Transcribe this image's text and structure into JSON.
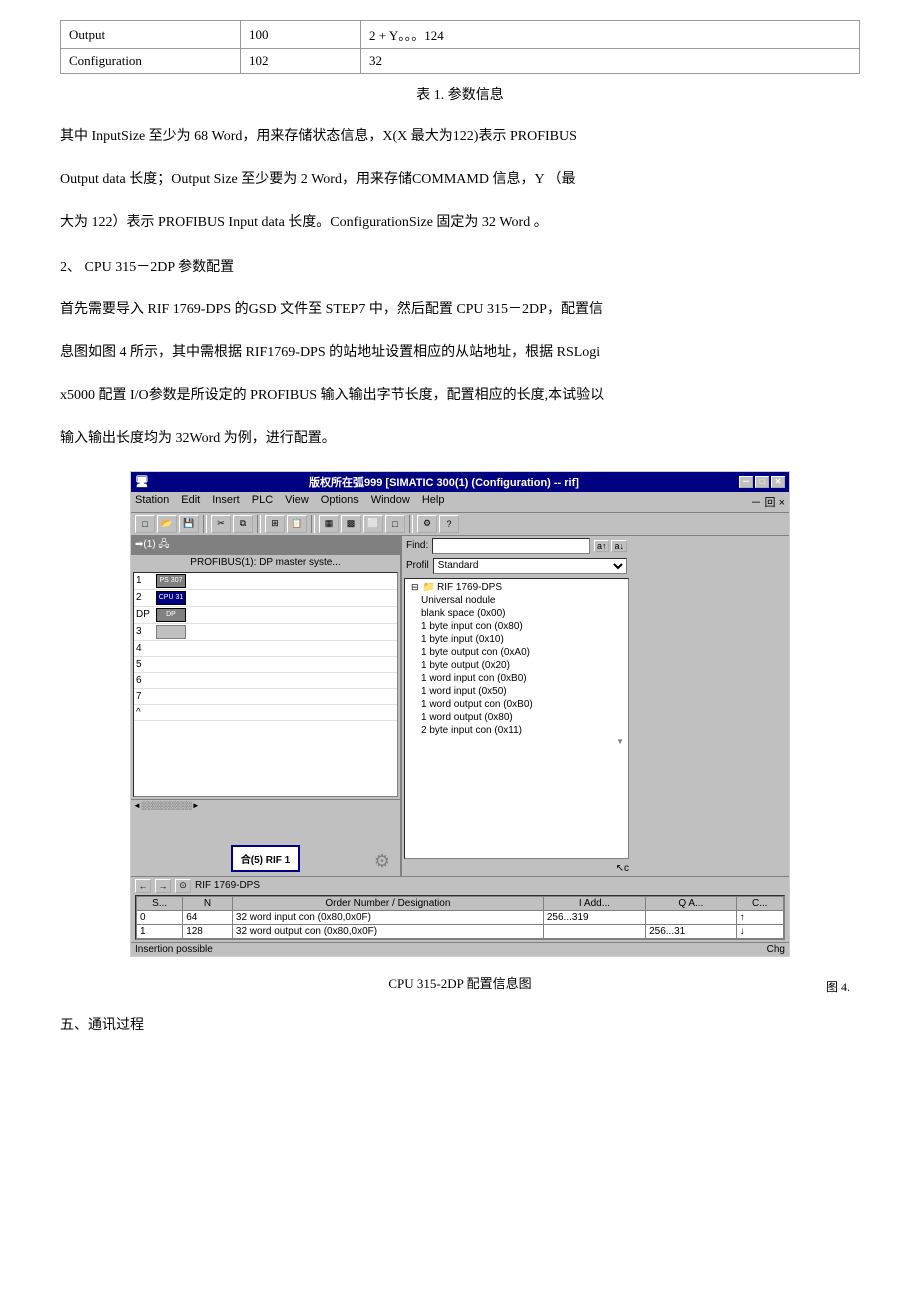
{
  "table": {
    "caption": "表 1. 参数信息",
    "rows": [
      {
        "col1": "Output",
        "col2": "100",
        "col3": "2 + Y。。。124"
      },
      {
        "col1": "Configuration",
        "col2": "102",
        "col3": "32"
      }
    ]
  },
  "paragraphs": {
    "p1": "其中 InputSize 至少为 68 Word，用来存储状态信息，X(X 最大为122)表示 PROFIBUS",
    "p2": "Output data 长度；Output Size 至少要为 2 Word，用来存储COMMAMD      信息，Y （最",
    "p3": "大为 122）表示 PROFIBUS      Input data 长度。ConfigurationSize 固定为 32 Word 。",
    "section2": "2、  CPU   315－2DP  参数配置",
    "p4": "首先需要导入 RIF  1769-DPS  的GSD  文件至 STEP7  中，然后配置 CPU   315－2DP，配置信",
    "p5": "息图如图 4 所示，其中需根据 RIF1769-DPS   的站地址设置相应的从站地址，根据 RSLogi",
    "p6": "x5000  配置 I/O参数是所设定的 PROFIBUS      输入输出字节长度，配置相应的长度,本试验以",
    "p7": "输入输出长度均为 32Word   为例，进行配置。"
  },
  "window": {
    "title": "版权所在弧999  [SIMATIC 300(1) (Configuration) -- rif]",
    "titlebar_btns": [
      "■",
      "□",
      "✕"
    ],
    "menubar": [
      "Station",
      "Edit",
      "Insert",
      "PLC",
      "View",
      "Options",
      "Window",
      "Help"
    ],
    "menubar_extra": "－ 回 ×",
    "profibus_label": "PROFIBUS(1): DP master syste...",
    "find_label": "Find:",
    "find_btn1": "a↑",
    "find_btn2": "a↓",
    "profil_label": "Profil",
    "profil_value": "Standard",
    "catalog_title": "RIF 1769-DPS",
    "catalog_items": [
      "Universal nodule",
      "blank space (0x00)",
      "1  byte input con   (0x80)",
      "1  byte input        (0x10)",
      "1  byte output con  (0xA0)",
      "1  byte output       (0x20)",
      "1  word input con   (0xB0)",
      "1  word input        (0x50)",
      "1  word output con  (0xB0)",
      "1  word output       (0x80)",
      "2  byte input con   (0x11)"
    ],
    "slots": [
      {
        "num": "1",
        "icon": "PS 307",
        "name": ""
      },
      {
        "num": "2",
        "icon": "CPU 31",
        "name": ""
      },
      {
        "num": "DP",
        "icon": "DP",
        "name": ""
      },
      {
        "num": "3",
        "icon": "",
        "name": ""
      },
      {
        "num": "4",
        "icon": "",
        "name": ""
      },
      {
        "num": "5",
        "icon": "",
        "name": ""
      },
      {
        "num": "6",
        "icon": "",
        "name": ""
      },
      {
        "num": "7",
        "icon": "",
        "name": ""
      }
    ],
    "rif_box": "合(5) RIF 1",
    "info_nav_label": "RIF 1769-DPS",
    "info_table_headers": [
      "S...",
      "N",
      "Order Number / Designation",
      "I Add...",
      "Q A...",
      "C..."
    ],
    "info_table_rows": [
      {
        "s": "0",
        "n": "64",
        "desc": "32 word input con  (0x80,0x0F)",
        "iadd": "256...319",
        "qa": "",
        "c": "↑"
      },
      {
        "s": "1",
        "n": "128",
        "desc": "32 word output con (0x80,0x0F)",
        "iadd": "",
        "qa": "256...31",
        "c": "↓"
      }
    ],
    "status_text": "Insertion possible",
    "status_right": "Chg",
    "fig_label": "图 4."
  },
  "screenshot_caption": "CPU   315-2DP  配置信息图",
  "final_section": "五、通讯过程"
}
